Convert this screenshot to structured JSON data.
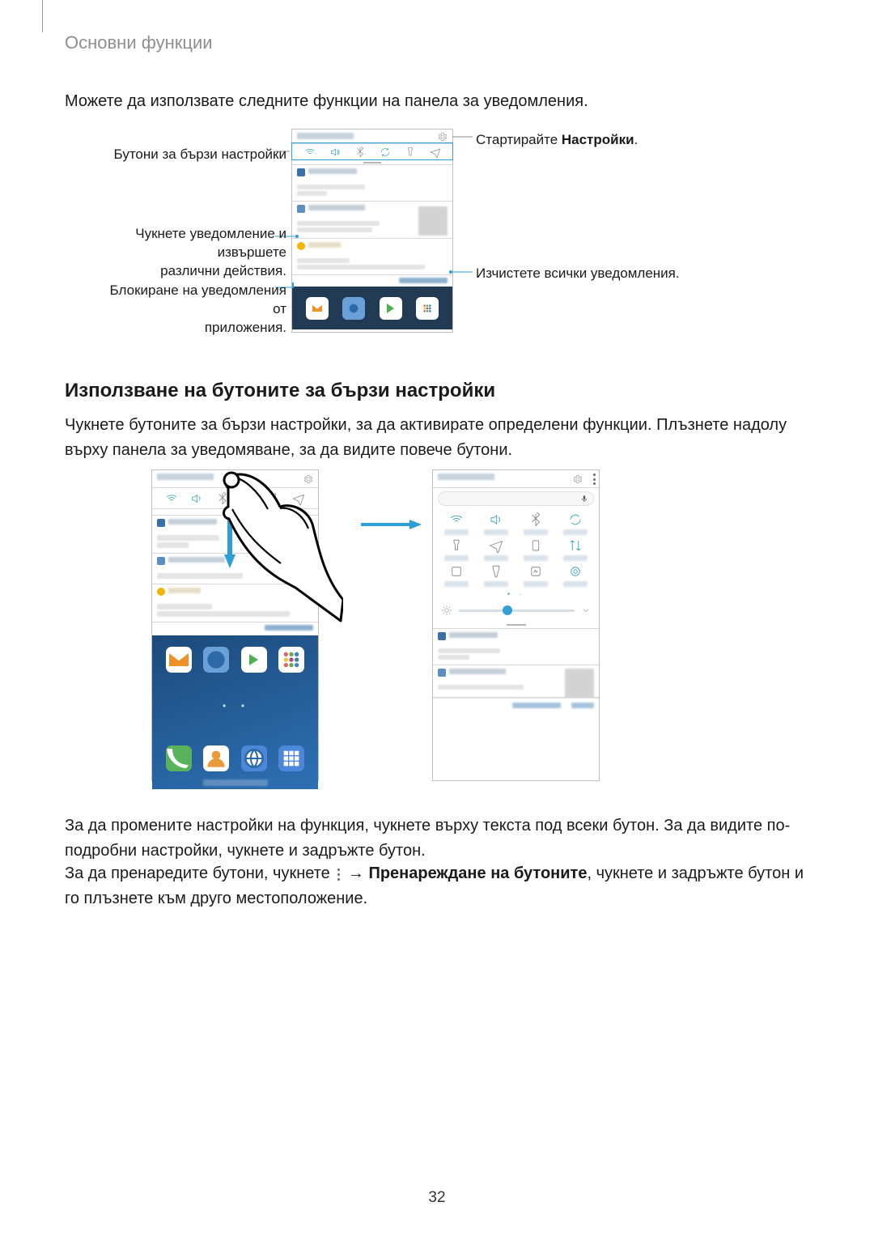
{
  "header": {
    "label": "Основни функции"
  },
  "intro": "Можете да използвате следните функции на панела за уведомления.",
  "fig1": {
    "callouts": {
      "quick_settings_buttons": "Бутони за бързи настройки",
      "launch_settings_prefix": "Стартирайте ",
      "launch_settings_bold": "Настройки",
      "launch_settings_suffix": ".",
      "tap_notification_line1": "Чукнете уведомление и извършете",
      "tap_notification_line2": "различни действия.",
      "block_line1": "Блокиране на уведомления от",
      "block_line2": "приложения.",
      "clear_all": "Изчистете всички уведомления."
    }
  },
  "section2": {
    "heading": "Използване на бутоните за бързи настройки",
    "para": "Чукнете бутоните за бързи настройки, за да активирате определени функции. Плъзнете надолу върху панела за уведомяване, за да видите повече бутони."
  },
  "para3": "За да промените настройки на функция, чукнете върху текста под всеки бутон. За да видите по-подробни настройки, чукнете и задръжте бутон.",
  "para4_prefix": "За да пренаредите бутони, чукнете ",
  "para4_arrow": " → ",
  "para4_bold": "Пренареждане на бутоните",
  "para4_suffix": ", чукнете и задръжте бутон и го плъзнете към друго местоположение.",
  "page_number": "32"
}
